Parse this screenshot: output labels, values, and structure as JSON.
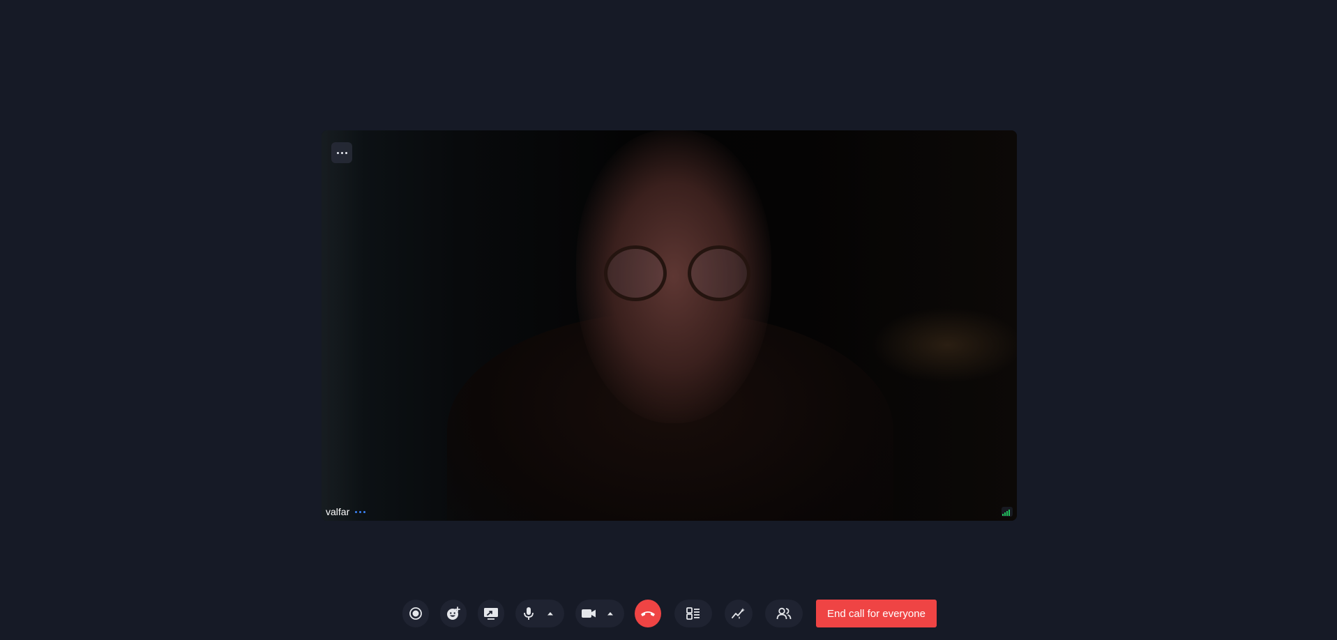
{
  "participant": {
    "name": "valfar"
  },
  "toolbar": {
    "record_icon": "record-icon",
    "reactions_icon": "emoji-add-icon",
    "share_screen_icon": "screen-share-icon",
    "mic_icon": "microphone-icon",
    "camera_icon": "camera-icon",
    "leave_icon": "phone-hangup-icon",
    "layout_icon": "layout-list-icon",
    "effects_icon": "sparkle-chart-icon",
    "people_icon": "people-icon",
    "end_for_everyone_label": "End call for everyone"
  },
  "colors": {
    "background": "#161a26",
    "button_bg": "#1f2331",
    "danger": "#ef4444",
    "signal": "#22c55e",
    "status_dots": "#3b82f6"
  }
}
